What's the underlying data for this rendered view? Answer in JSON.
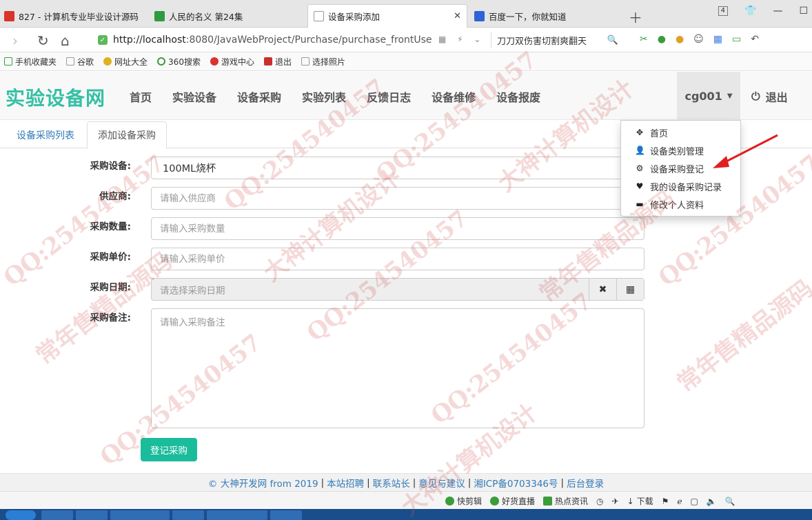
{
  "browser": {
    "tabs": [
      {
        "title": "827 - 计算机专业毕业设计源码",
        "favicon_color": "#d9342b"
      },
      {
        "title": "人民的名义 第24集",
        "favicon_color": "#2e9b3f"
      },
      {
        "title": "设备采购添加",
        "favicon_color": "#9a9a9a",
        "active": true
      },
      {
        "title": "百度一下，你就知道",
        "favicon_color": "#2f63d6"
      }
    ],
    "tab_count": "4",
    "url_host": "http://localhost",
    "url_rest": ":8080/JavaWebProject/Purchase/purchase_frontUse",
    "search_text": "刀刀双伤害切割爽翻天",
    "bookmarks": [
      "手机收藏夹",
      "谷歌",
      "网址大全",
      "360搜索",
      "游戏中心",
      "退出",
      "选择照片"
    ]
  },
  "site": {
    "brand": "实验设备网",
    "nav": [
      "首页",
      "实验设备",
      "设备采购",
      "实验列表",
      "反馈日志",
      "设备维修",
      "设备报废"
    ],
    "user": "cg001",
    "logout": "退出",
    "dropdown": [
      {
        "label": "首页",
        "icon": "move-icon"
      },
      {
        "label": "设备类别管理",
        "icon": "user-icon"
      },
      {
        "label": "设备采购登记",
        "icon": "cog-icon"
      },
      {
        "label": "我的设备采购记录",
        "icon": "heart-icon"
      },
      {
        "label": "修改个人资料",
        "icon": "credit-card-icon"
      }
    ]
  },
  "tabs": {
    "list": "设备采购列表",
    "add": "添加设备采购"
  },
  "form": {
    "equipment_label": "采购设备:",
    "equipment_value": "100ML烧杯",
    "supplier_label": "供应商:",
    "supplier_placeholder": "请输入供应商",
    "quantity_label": "采购数量:",
    "quantity_placeholder": "请输入采购数量",
    "price_label": "采购单价:",
    "price_placeholder": "请输入采购单价",
    "date_label": "采购日期:",
    "date_placeholder": "请选择采购日期",
    "note_label": "采购备注:",
    "note_placeholder": "请输入采购备注",
    "submit": "登记采购"
  },
  "footer": {
    "copyright": "© 大神开发网 from 2019",
    "links": [
      "本站招聘",
      "联系站长",
      "意见与建议",
      "湘ICP备0703346号",
      "后台登录"
    ]
  },
  "statusbar": [
    "快剪辑",
    "好货直播",
    "热点资讯",
    "下载"
  ],
  "watermark": [
    "QQ:254540457",
    "大神计算机设计",
    "常年售精品源码"
  ]
}
